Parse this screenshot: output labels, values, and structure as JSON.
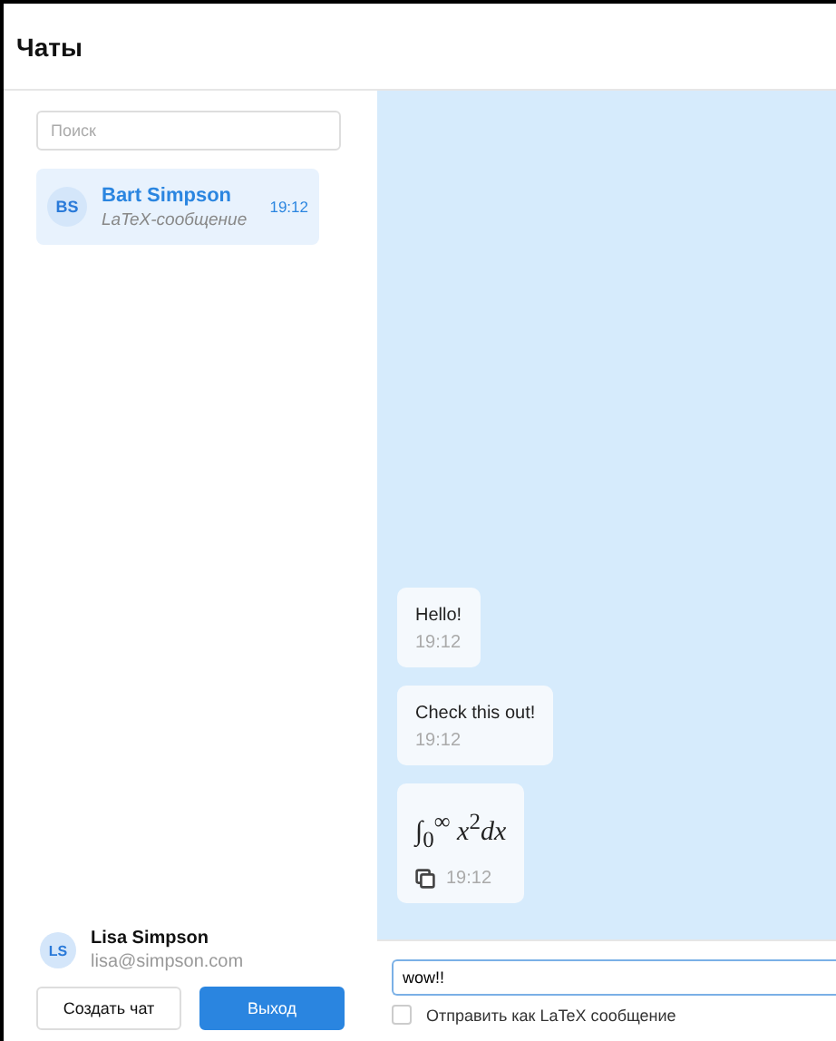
{
  "header": {
    "title": "Чаты"
  },
  "sidebar": {
    "search": {
      "placeholder": "Поиск"
    },
    "chats": [
      {
        "initials": "BS",
        "name": "Bart Simpson",
        "preview": "LaTeX-сообщение",
        "time": "19:12",
        "selected": true
      }
    ],
    "user": {
      "initials": "LS",
      "name": "Lisa Simpson",
      "email": "lisa@simpson.com"
    },
    "buttons": [
      {
        "label": "Создать чат",
        "kind": "secondary"
      },
      {
        "label": "Выход",
        "kind": "primary"
      }
    ]
  },
  "messages": [
    {
      "kind": "text",
      "text": "Hello!",
      "time": "19:12"
    },
    {
      "kind": "text",
      "text": "Check this out!",
      "time": "19:12"
    },
    {
      "kind": "latex",
      "text": "∫$_{0}$$^{∞}$ *x*$^{2}$*dx*",
      "time": "19:12"
    }
  ],
  "composer": {
    "value": "wow!!",
    "latex_option": {
      "label": "Отправить как LaTeX сообщение",
      "checked": false
    }
  }
}
